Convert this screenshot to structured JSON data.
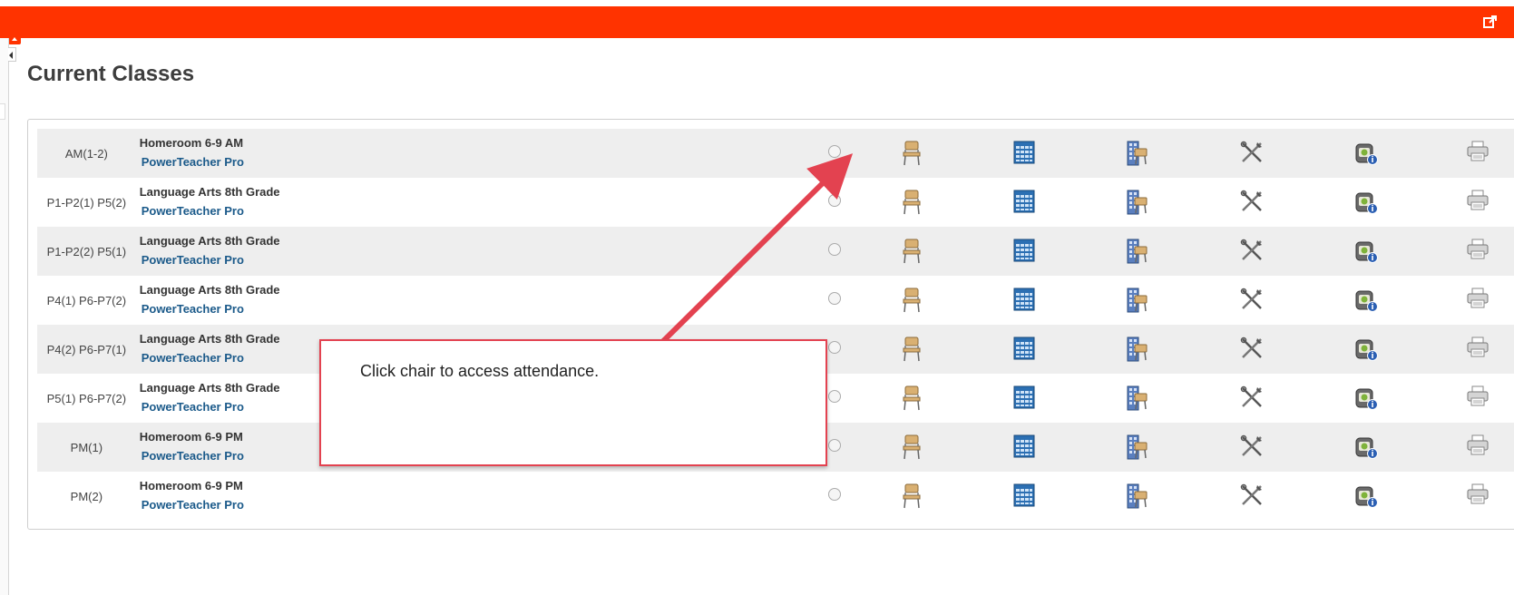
{
  "page": {
    "title": "Current Classes",
    "header_color": "#ff3300",
    "link_color": "#1b5a8a"
  },
  "classes": [
    {
      "period": "AM(1-2)",
      "course": "Homeroom 6-9 AM",
      "link": "PowerTeacher Pro"
    },
    {
      "period": "P1-P2(1) P5(2)",
      "course": "Language Arts 8th Grade",
      "link": "PowerTeacher Pro"
    },
    {
      "period": "P1-P2(2) P5(1)",
      "course": "Language Arts 8th Grade",
      "link": "PowerTeacher Pro"
    },
    {
      "period": "P4(1) P6-P7(2)",
      "course": "Language Arts 8th Grade",
      "link": "PowerTeacher Pro"
    },
    {
      "period": "P4(2) P6-P7(1)",
      "course": "Language Arts 8th Grade",
      "link": "PowerTeacher Pro"
    },
    {
      "period": "P5(1) P6-P7(2)",
      "course": "Language Arts 8th Grade",
      "link": "PowerTeacher Pro"
    },
    {
      "period": "PM(1)",
      "course": "Homeroom 6-9 PM",
      "link": "PowerTeacher Pro"
    },
    {
      "period": "PM(2)",
      "course": "Homeroom 6-9 PM",
      "link": "PowerTeacher Pro"
    }
  ],
  "row_icons": [
    "radio-icon",
    "chair-attendance-icon",
    "gradebook-grid-icon",
    "seating-chart-icon",
    "tools-icon",
    "student-backpack-info-icon",
    "printer-icon"
  ],
  "callout": {
    "text": "Click chair to access attendance.",
    "border_color": "#e34250"
  }
}
